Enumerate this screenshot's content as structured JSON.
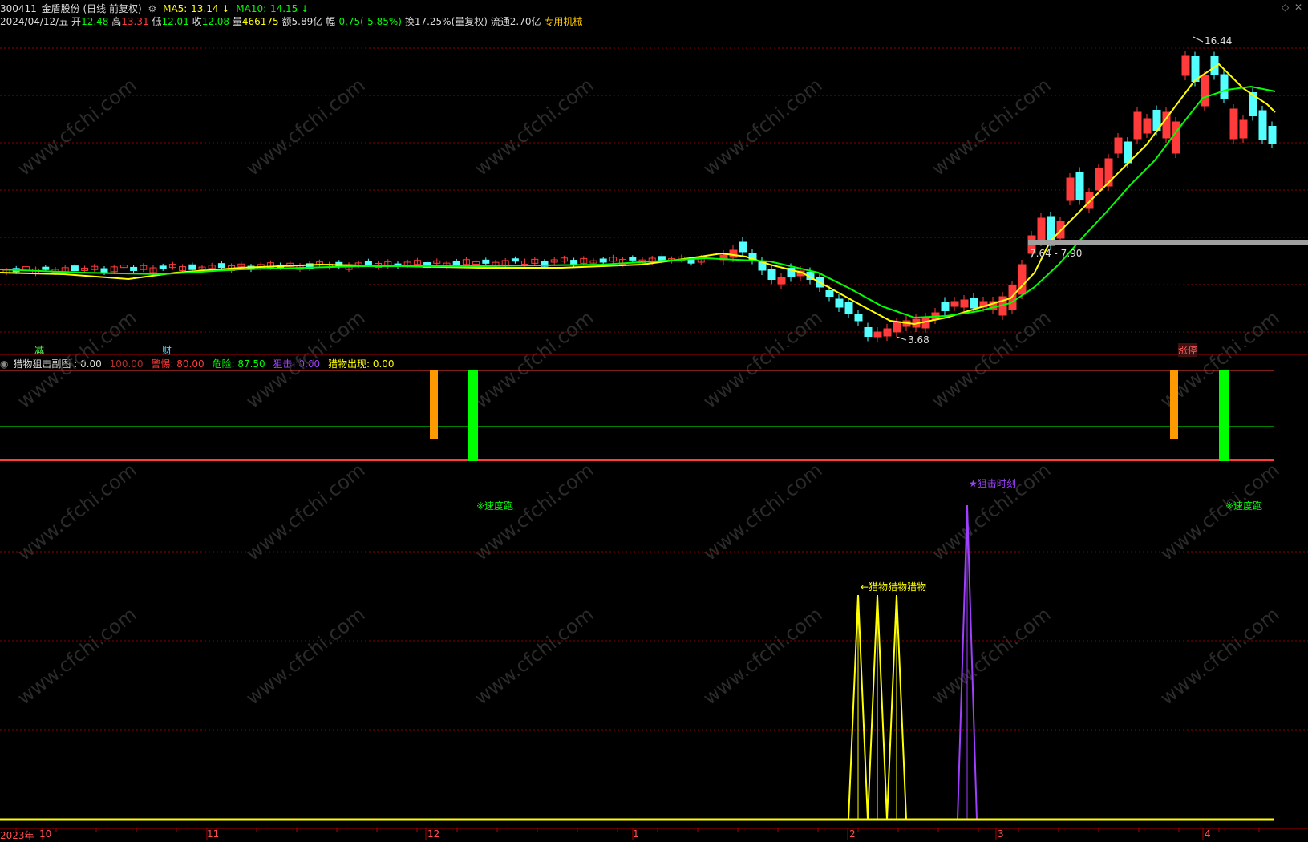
{
  "header": {
    "code": "300411",
    "name": "金盾股份",
    "mode": "(日线 前复权)",
    "ma5_label": "MA5:",
    "ma5_value": "13.14",
    "ma5_arrow": "↓",
    "ma10_label": "MA10:",
    "ma10_value": "14.15",
    "ma10_arrow": "↓",
    "date": "2024/04/12/五",
    "open_label": "开",
    "open": "12.48",
    "high_label": "高",
    "high": "13.31",
    "low_label": "低",
    "low": "12.01",
    "close_label": "收",
    "close": "12.08",
    "vol_label": "量",
    "vol": "466175",
    "amt_label": "额",
    "amt": "5.89亿",
    "chg_label": "幅",
    "chg": "-0.75(-5.85%)",
    "turnover": "换17.25%(量复权)",
    "float": "流通2.70亿",
    "sector": "专用机械"
  },
  "main_chart": {
    "high_label": "16.44",
    "low_label": "3.68",
    "range_label": "7.64 - 7.90",
    "marker_jian": "减",
    "marker_cai": "财",
    "marker_zt": "涨停"
  },
  "indicator": {
    "name": "猎物狙击副图",
    "value": ": 0.00",
    "v100": "100.00",
    "warn_label": "警惕:",
    "warn": "80.00",
    "danger_label": "危险:",
    "danger": "87.50",
    "snipe_label": "狙击:",
    "snipe": "0.00",
    "prey_label": "猎物出现:",
    "prey": "0.00",
    "text_speed1": "※速度跑",
    "text_speed2": "※速度跑",
    "text_snipe": "★狙击时刻",
    "text_prey": "←猎物猎物猎物"
  },
  "time_axis": [
    "2023年",
    "10",
    "11",
    "12",
    "1",
    "2",
    "3",
    "4"
  ],
  "watermark": "www.cfchi.com",
  "icons": [
    "gear-icon",
    "diamond-icon",
    "close-icon",
    "collapse-icon"
  ],
  "colors": {
    "up": "#ff3b3b",
    "down": "#54ffff",
    "ma5": "#ffff00",
    "ma10": "#00ff00",
    "grid": "#8b0000"
  }
}
